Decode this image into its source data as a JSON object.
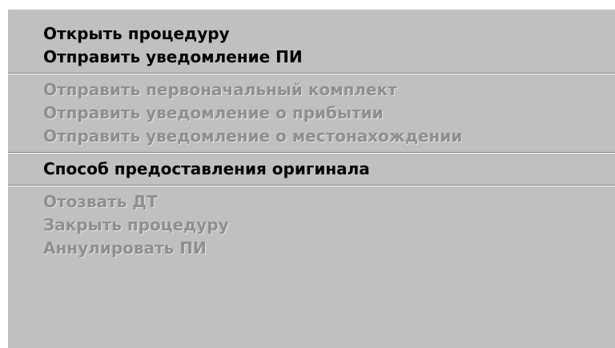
{
  "context_menu": {
    "group1": [
      {
        "label": "Открыть процедуру",
        "enabled": true
      },
      {
        "label": "Отправить уведомление ПИ",
        "enabled": true
      }
    ],
    "group2": [
      {
        "label": "Отправить первоначальный комплект",
        "enabled": false
      },
      {
        "label": "Отправить уведомление о прибытии",
        "enabled": false
      },
      {
        "label": "Отправить уведомление о местонахождении",
        "enabled": false
      }
    ],
    "group3": [
      {
        "label": "Способ предоставления оригинала",
        "enabled": true
      }
    ],
    "group4": [
      {
        "label": "Отозвать ДТ",
        "enabled": false
      },
      {
        "label": "Закрыть процедуру",
        "enabled": false
      },
      {
        "label": "Аннулировать ПИ",
        "enabled": false
      }
    ]
  }
}
